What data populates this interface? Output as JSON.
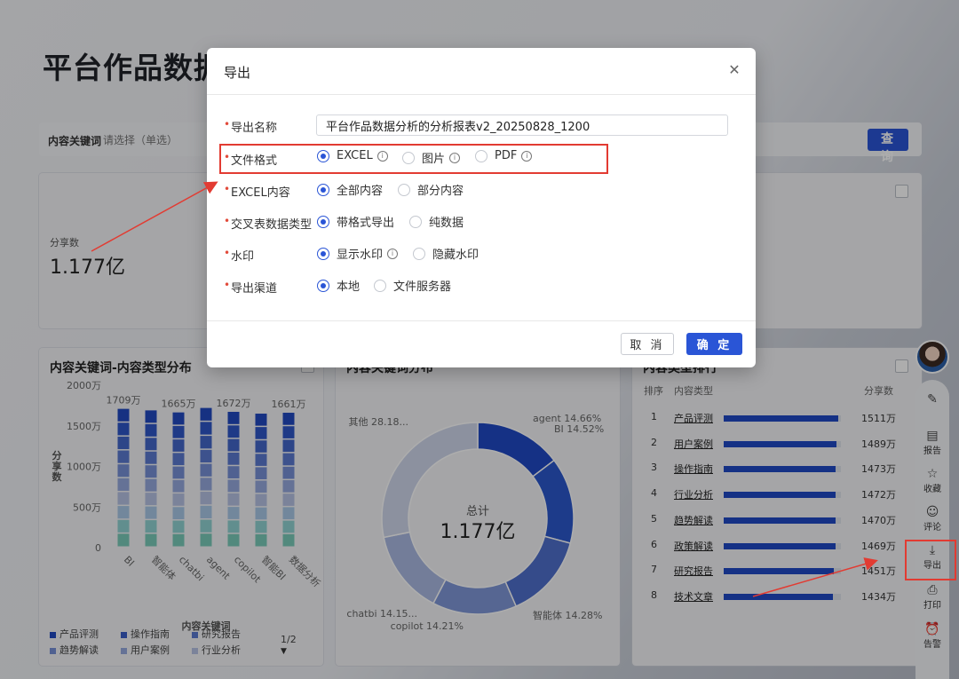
{
  "page": {
    "title": "平台作品数据"
  },
  "filter": {
    "label": "内容关键词",
    "placeholder": "请选择（单选）",
    "query_label": "查 询"
  },
  "kpi": {
    "label": "分享数",
    "value": "1.177亿"
  },
  "cards": {
    "bar_title": "内容关键词-内容类型分布",
    "donut_title": "内容关键词分布",
    "rank_title": "内容类型排行"
  },
  "dialog": {
    "title": "导出",
    "name_label": "导出名称",
    "name_value": "平台作品数据分析的分析报表v2_20250828_1200",
    "format_label": "文件格式",
    "format_options": [
      "EXCEL",
      "图片",
      "PDF"
    ],
    "format_selected": "EXCEL",
    "excel_label": "EXCEL内容",
    "excel_options": [
      "全部内容",
      "部分内容"
    ],
    "cross_label": "交叉表数据类型",
    "cross_options": [
      "带格式导出",
      "纯数据"
    ],
    "watermark_label": "水印",
    "watermark_options": [
      "显示水印",
      "隐藏水印"
    ],
    "channel_label": "导出渠道",
    "channel_options": [
      "本地",
      "文件服务器"
    ],
    "cancel_label": "取 消",
    "ok_label": "确 定"
  },
  "bar_chart": {
    "type": "bar",
    "categories": [
      "BI",
      "智能体",
      "chatbi",
      "agent",
      "copilot",
      "智能BI",
      "数据分析"
    ],
    "totals": [
      1709,
      1690,
      1665,
      1720,
      1672,
      1650,
      1661
    ],
    "total_labels": [
      "1709万",
      "",
      "1665万",
      "",
      "1672万",
      "",
      "1661万"
    ],
    "y_ticks": [
      "2000万",
      "1500万",
      "1000万",
      "500万",
      "0"
    ],
    "y_values": [
      2000,
      1500,
      1000,
      500,
      0
    ],
    "ylabel": "分享数",
    "xlabel": "内容关键词",
    "series_colors": [
      "#2149c0",
      "#2e56c8",
      "#4366c9",
      "#5a7ad0",
      "#7690d6",
      "#95a9dd",
      "#b6c2e3",
      "#a9c7e6",
      "#8fd2d2",
      "#79cbb8"
    ],
    "legend": [
      "产品评测",
      "操作指南",
      "研究报告",
      "趋势解读",
      "用户案例",
      "行业分析"
    ],
    "legend_colors": [
      "#2149c0",
      "#3a5dc8",
      "#5a7ad0",
      "#7690d6",
      "#95a9dd",
      "#b6c2e3"
    ],
    "pager": "1/2"
  },
  "donut_chart": {
    "type": "pie",
    "center_label": "总计",
    "center_value": "1.177亿",
    "slices": [
      {
        "name": "agent",
        "pct": 14.66,
        "label": "agent 14.66%",
        "color": "#1f49c5"
      },
      {
        "name": "BI",
        "pct": 14.52,
        "label": "BI 14.52%",
        "color": "#2c58cc"
      },
      {
        "name": "智能体",
        "pct": 14.28,
        "label": "智能体 14.28%",
        "color": "#4f6fcc"
      },
      {
        "name": "copilot",
        "pct": 14.21,
        "label": "copilot 14.21%",
        "color": "#7f97d8"
      },
      {
        "name": "chatbi",
        "pct": 14.15,
        "label": "chatbi 14.15...",
        "color": "#aab9e2"
      },
      {
        "name": "其他",
        "pct": 28.18,
        "label": "其他 28.18...",
        "color": "#cfd6ea"
      }
    ]
  },
  "rank": {
    "col_rank": "排序",
    "col_type": "内容类型",
    "col_value": "分享数",
    "max": 1511,
    "rows": [
      {
        "idx": "1",
        "name": "产品评测",
        "value": 1511,
        "label": "1511万"
      },
      {
        "idx": "2",
        "name": "用户案例",
        "value": 1489,
        "label": "1489万"
      },
      {
        "idx": "3",
        "name": "操作指南",
        "value": 1473,
        "label": "1473万"
      },
      {
        "idx": "4",
        "name": "行业分析",
        "value": 1472,
        "label": "1472万"
      },
      {
        "idx": "5",
        "name": "趋势解读",
        "value": 1470,
        "label": "1470万"
      },
      {
        "idx": "6",
        "name": "政策解读",
        "value": 1469,
        "label": "1469万"
      },
      {
        "idx": "7",
        "name": "研究报告",
        "value": 1451,
        "label": "1451万"
      },
      {
        "idx": "8",
        "name": "技术文章",
        "value": 1434,
        "label": "1434万"
      }
    ]
  },
  "side_panel": {
    "items": [
      {
        "icon": "edit-icon",
        "label": ""
      },
      {
        "icon": "report-icon",
        "label": "报告"
      },
      {
        "icon": "star-icon",
        "label": "收藏"
      },
      {
        "icon": "comment-icon",
        "label": "评论"
      },
      {
        "icon": "download-icon",
        "label": "导出"
      },
      {
        "icon": "print-icon",
        "label": "打印"
      },
      {
        "icon": "alarm-icon",
        "label": "告警"
      }
    ]
  }
}
